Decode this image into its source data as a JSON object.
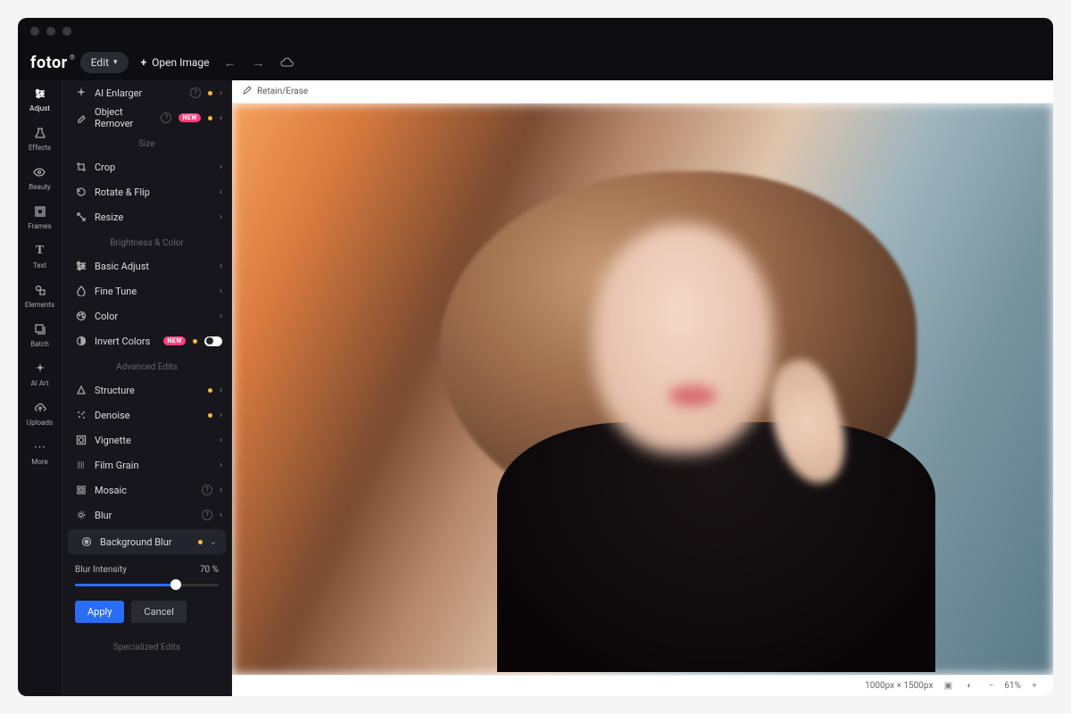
{
  "logo": "fotor",
  "topbar": {
    "edit_label": "Edit",
    "open_image": "Open Image"
  },
  "leftnav": [
    {
      "id": "adjust",
      "label": "Adjust",
      "icon": "sliders"
    },
    {
      "id": "effects",
      "label": "Effects",
      "icon": "flask"
    },
    {
      "id": "beauty",
      "label": "Beauty",
      "icon": "eye"
    },
    {
      "id": "frames",
      "label": "Frames",
      "icon": "frame"
    },
    {
      "id": "text",
      "label": "Text",
      "icon": "text"
    },
    {
      "id": "elements",
      "label": "Elements",
      "icon": "shapes"
    },
    {
      "id": "batch",
      "label": "Batch",
      "icon": "stack"
    },
    {
      "id": "aiart",
      "label": "AI Art",
      "icon": "sparkle"
    },
    {
      "id": "uploads",
      "label": "Uploads",
      "icon": "cloud-up"
    },
    {
      "id": "more",
      "label": "More",
      "icon": "dots"
    }
  ],
  "leftnav_active": "adjust",
  "panel": {
    "top_tools": [
      {
        "id": "ai-enlarger",
        "label": "AI Enlarger",
        "icon": "sparkle",
        "help": true,
        "gold": true
      },
      {
        "id": "object-remover",
        "label": "Object Remover",
        "icon": "eraser",
        "help": true,
        "new": true,
        "gold": true
      }
    ],
    "sections": [
      {
        "title": "Size",
        "items": [
          {
            "id": "crop",
            "label": "Crop",
            "icon": "crop"
          },
          {
            "id": "rotate-flip",
            "label": "Rotate & Flip",
            "icon": "rotate"
          },
          {
            "id": "resize",
            "label": "Resize",
            "icon": "resize"
          }
        ]
      },
      {
        "title": "Brightness & Color",
        "items": [
          {
            "id": "basic-adjust",
            "label": "Basic Adjust",
            "icon": "sliders"
          },
          {
            "id": "fine-tune",
            "label": "Fine Tune",
            "icon": "drop"
          },
          {
            "id": "color",
            "label": "Color",
            "icon": "palette"
          },
          {
            "id": "invert-colors",
            "label": "Invert Colors",
            "icon": "contrast",
            "new": true,
            "gold": true,
            "toggle": true
          }
        ]
      },
      {
        "title": "Advanced Edits",
        "items": [
          {
            "id": "structure",
            "label": "Structure",
            "icon": "triangle",
            "gold": true
          },
          {
            "id": "denoise",
            "label": "Denoise",
            "icon": "noise",
            "gold": true
          },
          {
            "id": "vignette",
            "label": "Vignette",
            "icon": "vignette"
          },
          {
            "id": "film-grain",
            "label": "Film Grain",
            "icon": "grain"
          },
          {
            "id": "mosaic",
            "label": "Mosaic",
            "icon": "grid",
            "help": true
          },
          {
            "id": "blur",
            "label": "Blur",
            "icon": "blur",
            "help": true
          },
          {
            "id": "background-blur",
            "label": "Background Blur",
            "icon": "focus",
            "gold": true,
            "expanded": true
          }
        ]
      },
      {
        "title": "Specialized Edits",
        "items": []
      }
    ],
    "slider": {
      "label": "Blur Intensity",
      "value": 70,
      "suffix": "%"
    },
    "apply": "Apply",
    "cancel": "Cancel",
    "new_badge": "NEW"
  },
  "canvas": {
    "tool": "Retain/Erase",
    "dimensions": "1000px × 1500px",
    "zoom": "61%"
  }
}
